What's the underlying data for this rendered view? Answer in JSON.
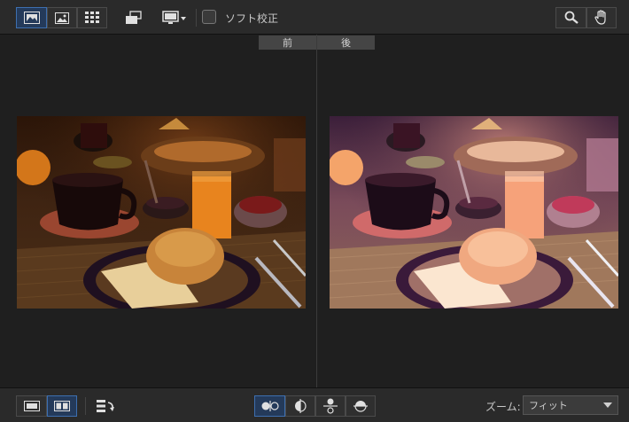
{
  "toolbar": {
    "soft_proof_label": "ソフト校正",
    "view_buttons": [
      "single-image-icon",
      "filmstrip-icon",
      "grid-icon"
    ],
    "rotate_icon": "rotate-display-icon",
    "monitor_icon": "monitor-dropdown-icon",
    "zoom_icon": "zoom-tool-icon",
    "hand_icon": "hand-tool-icon"
  },
  "compare": {
    "before_label": "前",
    "after_label": "後"
  },
  "bottom": {
    "zoom_label": "ズーム:",
    "zoom_value": "フィット",
    "layout_buttons": [
      "single-view-icon",
      "side-by-side-icon"
    ],
    "swap_icon": "swap-icon",
    "split_buttons": [
      "split-vertical-icon",
      "split-half-icon",
      "split-horizontal-icon",
      "split-horizontal-half-icon"
    ]
  },
  "colors": {
    "accent": "#3d6fb0",
    "background": "#1e1e1e",
    "toolbar": "#2a2a2a"
  }
}
